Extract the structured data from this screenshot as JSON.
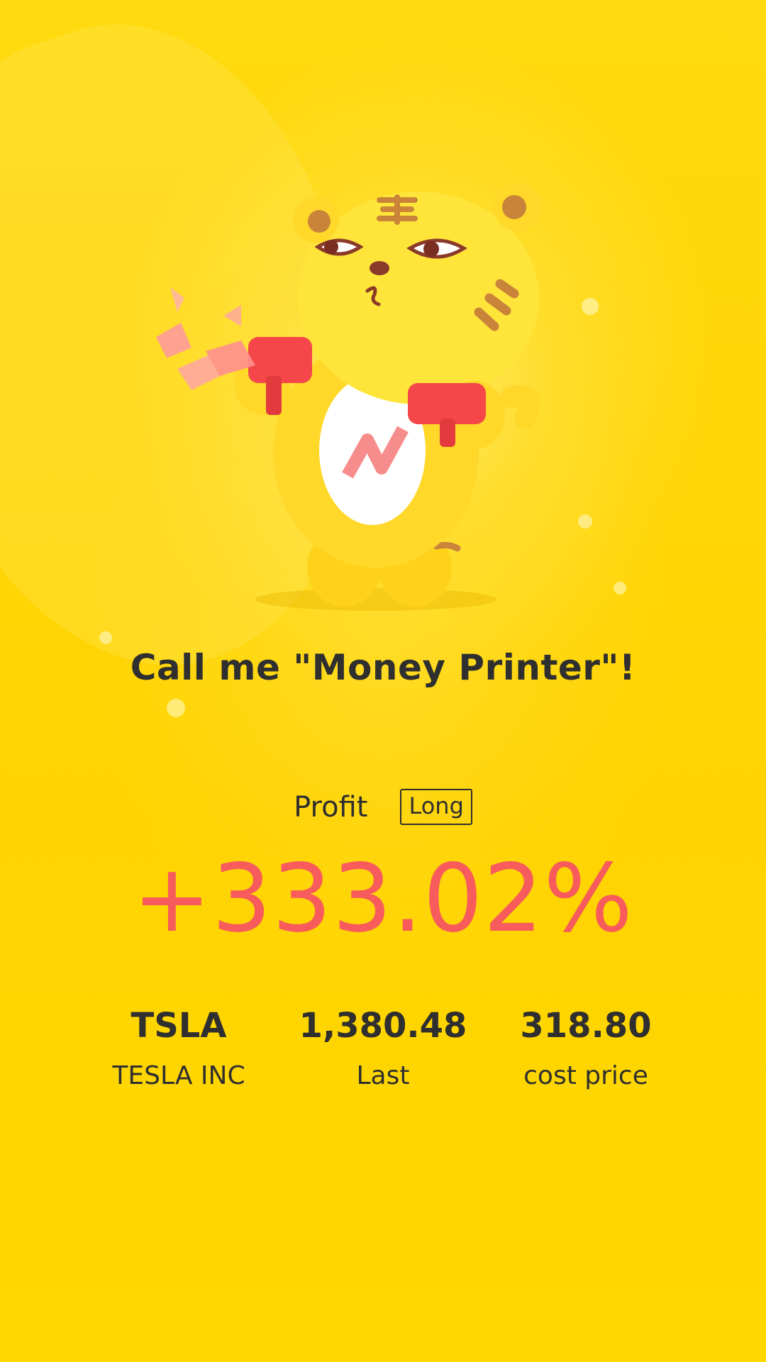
{
  "headline": "Call me \"Money Printer\"!",
  "profit": {
    "label": "Profit",
    "position_tag": "Long",
    "percent": "+333.02%"
  },
  "stats": [
    {
      "value": "TSLA",
      "label": "TESLA INC"
    },
    {
      "value": "1,380.48",
      "label": "Last"
    },
    {
      "value": "318.80",
      "label": "cost price"
    }
  ],
  "colors": {
    "background": "#FFD400",
    "text": "#2F2F2F",
    "profit": "#F75B5B"
  },
  "illustration": "tiger-mascot-with-money-guns"
}
